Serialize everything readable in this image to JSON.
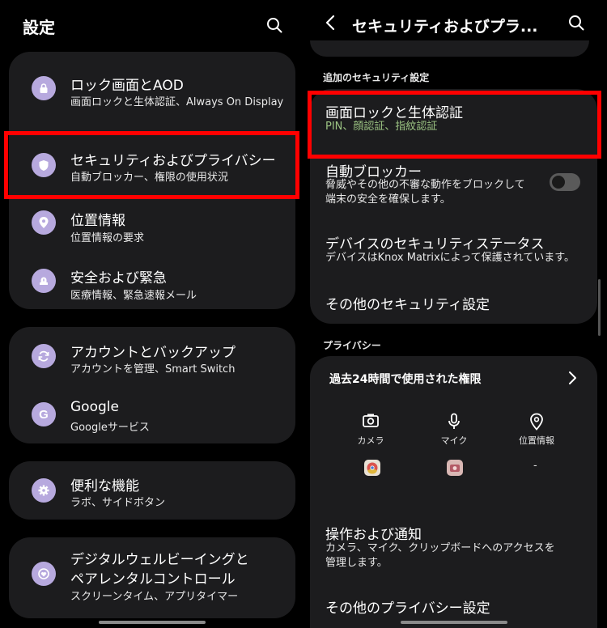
{
  "left": {
    "title": "設定",
    "items": [
      {
        "title": "ロック画面とAOD",
        "subtitle": "画面ロックと生体認証、Always On Display"
      },
      {
        "title": "セキュリティおよびプライバシー",
        "subtitle": "自動ブロッカー、権限の使用状況"
      },
      {
        "title": "位置情報",
        "subtitle": "位置情報の要求"
      },
      {
        "title": "安全および緊急",
        "subtitle": "医療情報、緊急速報メール"
      },
      {
        "title": "アカウントとバックアップ",
        "subtitle": "アカウントを管理、Smart Switch"
      },
      {
        "title": "Google",
        "subtitle": "Googleサービス"
      },
      {
        "title": "便利な機能",
        "subtitle": "ラボ、サイドボタン"
      },
      {
        "title_line1": "デジタルウェルビーイングと",
        "title_line2": "ペアレンタルコントロール",
        "subtitle": "スクリーンタイム、アプリタイマー"
      }
    ]
  },
  "right": {
    "title": "セキュリティおよびプラ...",
    "section_security": "追加のセキュリティ設定",
    "screen_lock": {
      "title": "画面ロックと生体認証",
      "subtitle": "PIN、顔認証、指紋認証"
    },
    "auto_blocker": {
      "title": "自動ブロッカー",
      "subtitle_line1": "脅威やその他の不審な動作をブロックして",
      "subtitle_line2": "端末の安全を確保します。",
      "enabled": false
    },
    "device_status": {
      "title": "デバイスのセキュリティステータス",
      "subtitle": "デバイスはKnox Matrixによって保護されています。"
    },
    "other_security": "その他のセキュリティ設定",
    "section_privacy": "プライバシー",
    "permissions_24h": {
      "title": "過去24時間で使用された権限",
      "items": [
        {
          "label": "カメラ",
          "icon": "camera-icon"
        },
        {
          "label": "マイク",
          "icon": "mic-icon"
        },
        {
          "label": "位置情報",
          "icon": "location-icon"
        }
      ],
      "location_none": "-"
    },
    "controls": {
      "title": "操作および通知",
      "subtitle_line1": "カメラ、マイク、クリップボードへのアクセスを",
      "subtitle_line2": "管理します。"
    },
    "other_privacy": "その他のプライバシー設定"
  },
  "colors": {
    "highlight": "#ff0000",
    "icon_bg": "#b7a9de",
    "card_bg": "#1c1c1e",
    "green_sub": "#9cc483"
  }
}
